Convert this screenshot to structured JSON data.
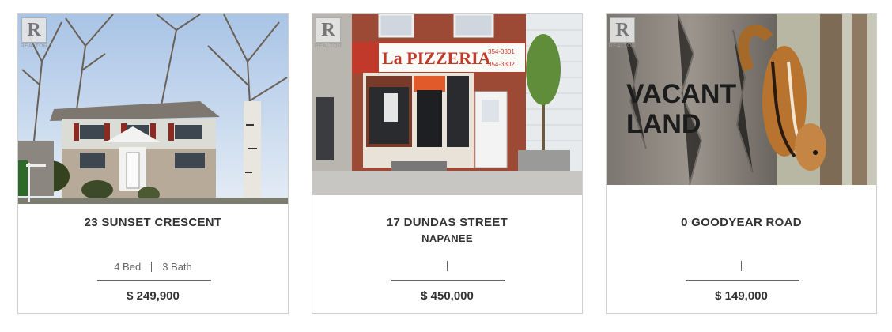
{
  "listings": [
    {
      "address": "23 SUNSET CRESCENT",
      "city": "",
      "beds": "4 Bed",
      "baths": "3 Bath",
      "price": "$ 249,900",
      "badge_logo": "R",
      "badge_text": "REALTOR"
    },
    {
      "address": "17 DUNDAS STREET",
      "city": "NAPANEE",
      "beds": "",
      "baths": "",
      "price": "$ 450,000",
      "badge_logo": "R",
      "badge_text": "REALTOR",
      "sign_text": "La PIZZERIA",
      "phone_1": "354-3301",
      "phone_2": "354-3302"
    },
    {
      "address": "0 GOODYEAR ROAD",
      "city": "",
      "beds": "",
      "baths": "",
      "price": "$ 149,000",
      "badge_logo": "R",
      "badge_text": "REALTOR",
      "photo_text_1": "VACANT",
      "photo_text_2": "LAND"
    }
  ],
  "colors": {
    "text": "#333333",
    "muted": "#666666",
    "border": "#cfcfcf"
  }
}
